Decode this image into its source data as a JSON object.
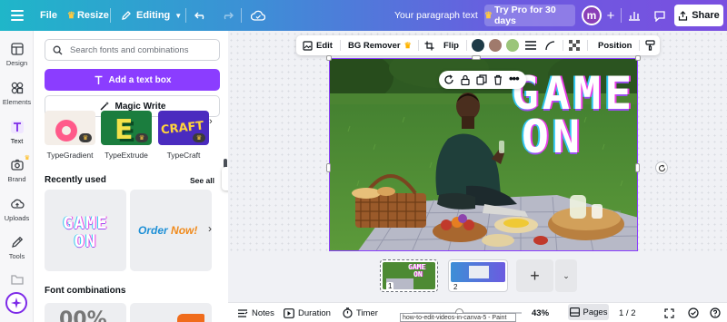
{
  "topbar": {
    "file": "File",
    "resize": "Resize",
    "editing": "Editing",
    "doc_title": "Your paragraph text",
    "try_pro": "Try Pro for 30 days",
    "avatar_letter": "m",
    "share": "Share",
    "gradient_colors": [
      "#1fb6c9",
      "#6b5be0",
      "#7a4fe0"
    ]
  },
  "rail": {
    "items": [
      {
        "label": "Design",
        "icon": "layout-icon"
      },
      {
        "label": "Elements",
        "icon": "shapes-icon"
      },
      {
        "label": "Text",
        "icon": "text-t-icon"
      },
      {
        "label": "Brand",
        "icon": "brand-icon"
      },
      {
        "label": "Uploads",
        "icon": "cloud-upload-icon"
      },
      {
        "label": "Tools",
        "icon": "pencil-icon"
      }
    ]
  },
  "panel": {
    "search_placeholder": "Search fonts and combinations",
    "add_text_box": "Add a text box",
    "magic_write": "Magic Write",
    "styles": [
      {
        "label": "TypeGradient"
      },
      {
        "label": "TypeExtrude",
        "tile_text": "E"
      },
      {
        "label": "TypeCraft",
        "tile_text": "CRAFT"
      }
    ],
    "recently_used_title": "Recently used",
    "see_all": "See all",
    "recent": [
      {
        "line1": "GAME",
        "line2": "ON"
      },
      {
        "text": "Order",
        "accent": "Now!"
      }
    ],
    "font_combinations_title": "Font combinations",
    "font_combo_preview": "00%"
  },
  "context_toolbar": {
    "edit": "Edit",
    "bg_remover": "BG Remover",
    "flip": "Flip",
    "position": "Position",
    "swatches": [
      "#1e3a46",
      "#a07a6c",
      "#9bc57a"
    ]
  },
  "design": {
    "headline_line1": "GAME",
    "headline_line2": "ON"
  },
  "pages": {
    "thumbs": [
      {
        "number": "1"
      },
      {
        "number": "2"
      }
    ],
    "add": "+"
  },
  "bottombar": {
    "notes": "Notes",
    "duration": "Duration",
    "timer": "Timer",
    "zoom": "43%",
    "pages": "Pages",
    "page_count": "1 / 2",
    "tooltip": "how-to-edit-videos-in-canva-5 - Paint",
    "zoom_fraction": 0.43
  }
}
